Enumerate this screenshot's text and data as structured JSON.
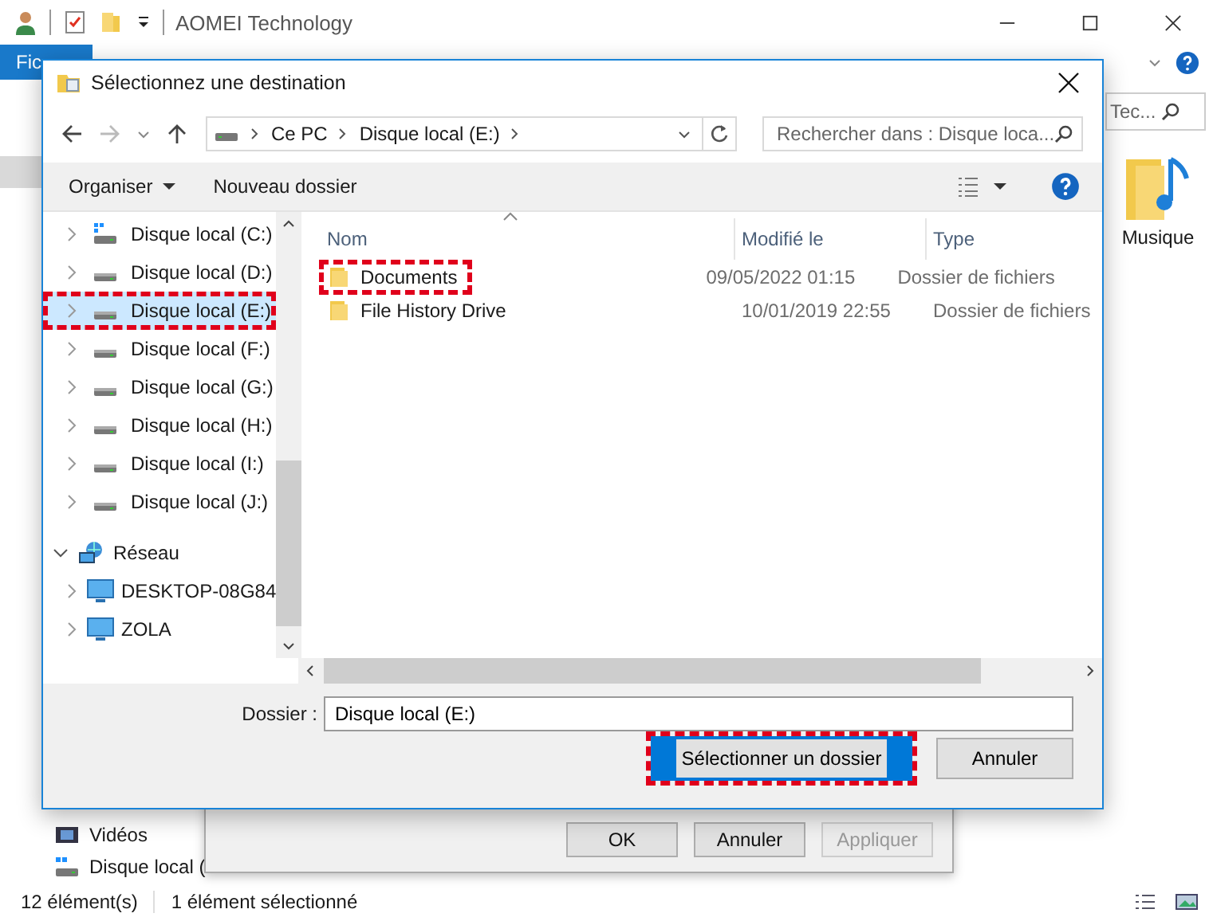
{
  "background_window": {
    "title": "AOMEI Technology",
    "ribbon_tab": "Fic",
    "search_placeholder": "Tec...",
    "desktop_item": "Musique",
    "nav_items": [
      {
        "label": "Vidéos",
        "kind": "videos"
      },
      {
        "label": "Disque local (",
        "kind": "system-drive"
      }
    ],
    "status_bar": {
      "count": "12 élément(s)",
      "selection": "1 élément sélectionné"
    }
  },
  "properties_dialog": {
    "buttons": [
      {
        "label": "OK",
        "disabled": false
      },
      {
        "label": "Annuler",
        "disabled": false
      },
      {
        "label": "Appliquer",
        "disabled": true
      }
    ]
  },
  "file_dialog": {
    "title": "Sélectionnez une destination",
    "breadcrumb": [
      "Ce PC",
      "Disque local (E:)"
    ],
    "search": {
      "placeholder": "Rechercher dans : Disque loca..."
    },
    "toolbar": {
      "organize": "Organiser",
      "new_folder": "Nouveau dossier"
    },
    "tree": [
      {
        "label": "Disque local (C:)",
        "kind": "system-drive",
        "expanded": false,
        "selected": false,
        "highlighted": false
      },
      {
        "label": "Disque local (D:)",
        "kind": "drive",
        "expanded": false,
        "selected": false,
        "highlighted": false
      },
      {
        "label": "Disque local (E:)",
        "kind": "drive",
        "expanded": false,
        "selected": true,
        "highlighted": true
      },
      {
        "label": "Disque local (F:)",
        "kind": "drive",
        "expanded": false,
        "selected": false,
        "highlighted": false
      },
      {
        "label": "Disque local (G:)",
        "kind": "drive",
        "expanded": false,
        "selected": false,
        "highlighted": false
      },
      {
        "label": "Disque local (H:)",
        "kind": "drive",
        "expanded": false,
        "selected": false,
        "highlighted": false
      },
      {
        "label": "Disque local (I:)",
        "kind": "drive",
        "expanded": false,
        "selected": false,
        "highlighted": false
      },
      {
        "label": "Disque local (J:)",
        "kind": "drive",
        "expanded": false,
        "selected": false,
        "highlighted": false
      },
      {
        "label": "Réseau",
        "kind": "network",
        "expanded": true,
        "selected": false,
        "highlighted": false,
        "children": [
          {
            "label": "DESKTOP-08G84",
            "kind": "computer",
            "expanded": false,
            "selected": false,
            "highlighted": false
          },
          {
            "label": "ZOLA",
            "kind": "computer",
            "expanded": false,
            "selected": false,
            "highlighted": false
          }
        ]
      }
    ],
    "columns": [
      "Nom",
      "Modifié le",
      "Type"
    ],
    "files": [
      {
        "name": "Documents",
        "modified": "09/05/2022 01:15",
        "type": "Dossier de fichiers",
        "highlighted": true
      },
      {
        "name": "File History Drive",
        "modified": "10/01/2019 22:55",
        "type": "Dossier de fichiers",
        "highlighted": false
      }
    ],
    "folder_field": {
      "label": "Dossier :",
      "value": "Disque local (E:)"
    },
    "buttons": [
      {
        "label": "Sélectionner un dossier",
        "primary": true,
        "highlighted": true
      },
      {
        "label": "Annuler",
        "primary": false,
        "highlighted": false
      }
    ]
  }
}
